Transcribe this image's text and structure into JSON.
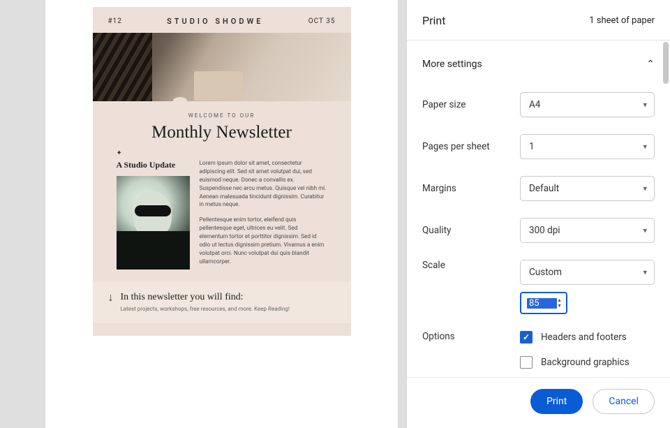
{
  "preview": {
    "issue": "#12",
    "brand": "STUDIO SHODWE",
    "date": "OCT 35",
    "welcome": "WELCOME TO OUR",
    "headline": "Monthly Newsletter",
    "sparkle": "✦",
    "subhead": "A Studio Update",
    "para1": "Lorem ipsum dolor sit amet, consectetur adipiscing elit. Sed sit amet volutpat dui, sed euismod neque. Donec a convallis ex. Suspendisse nec arcu metus. Quisque vel nibh mi. Aenean malesuada tincidunt dignissim. Curabitur in metus neque.",
    "para2": "Pellentesque enim tortor, eleifend quis pellentesque eget, ultrices eu velit. Sed elementum tortor et porttitor dignissim. Sed id odio ut lectus dignissim pretium. Vivamus a enim volutpat orci. Nunc volutpat dui quis blandit ullamcorper.",
    "footer_title": "In this newsletter you will find:",
    "footer_sub": "Latest projects, workshops, free resources, and more. Keep Reading!"
  },
  "panel": {
    "title": "Print",
    "sheet_count": "1 sheet of paper",
    "more_settings": "More settings",
    "rows": {
      "paper_size_label": "Paper size",
      "paper_size_value": "A4",
      "pages_per_sheet_label": "Pages per sheet",
      "pages_per_sheet_value": "1",
      "margins_label": "Margins",
      "margins_value": "Default",
      "quality_label": "Quality",
      "quality_value": "300 dpi",
      "scale_label": "Scale",
      "scale_value": "Custom",
      "scale_number": "85",
      "options_label": "Options",
      "headers_footers": "Headers and footers",
      "background_graphics": "Background graphics"
    },
    "buttons": {
      "print": "Print",
      "cancel": "Cancel"
    }
  }
}
